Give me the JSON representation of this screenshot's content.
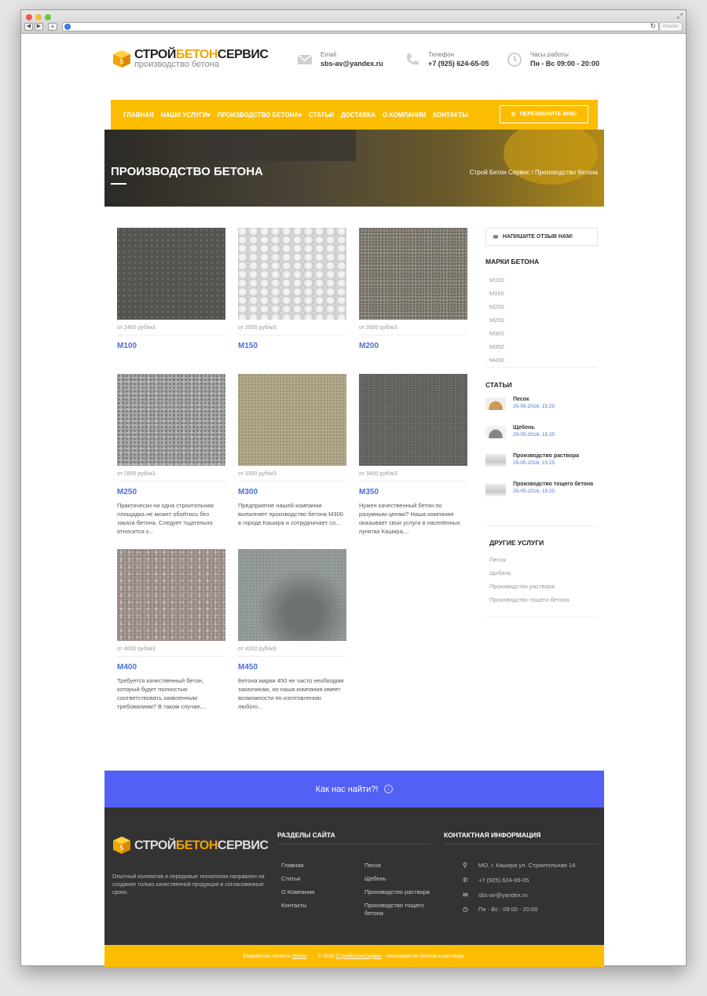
{
  "browser": {
    "reader_label": "Reader"
  },
  "header": {
    "logo_title_a": "СТРОЙ",
    "logo_title_b": "БЕТОН",
    "logo_title_c": "СЕРВИС",
    "logo_sub": "производство бетона",
    "email_label": "Email",
    "email_value": "sbs-av@yandex.ru",
    "phone_label": "Телефон",
    "phone_value": "+7 (925) 624-65-05",
    "hours_label": "Часы работы",
    "hours_value": "Пн - Вс 09:00 - 20:00"
  },
  "nav": {
    "items": [
      "ГЛАВНАЯ",
      "НАШИ УСЛУГИ▾",
      "ПРОИЗВОДСТВО БЕТОНА▾",
      "СТАТЬИ",
      "ДОСТАВКА",
      "О КОМПАНИИ",
      "КОНТАКТЫ"
    ],
    "callback": "ПЕРЕЗВОНИТЕ МНЕ!"
  },
  "hero": {
    "title": "ПРОИЗВОДСТВО БЕТОНА",
    "breadcrumb": "Строй Бетон Сервис / Производство бетона"
  },
  "products": [
    {
      "price": "от 2400 руб/м3.",
      "name": "М100",
      "desc": ""
    },
    {
      "price": "от 2500 руб/м3.",
      "name": "М150",
      "desc": ""
    },
    {
      "price": "от 2600 руб/м3.",
      "name": "М200",
      "desc": ""
    },
    {
      "price": "от 2800 руб/м3.",
      "name": "М250",
      "desc": "Практически ни одна строительная площадка не может обойтись без заказа бетона. Следует тщательно относится к..."
    },
    {
      "price": "от 3300 руб/м3.",
      "name": "М300",
      "desc": "Предприятие нашей компании выполняет производство бетона М300 в городе Кашира и сотрудничает со..."
    },
    {
      "price": "от 3400 руб/м3.",
      "name": "М350",
      "desc": "Нужен качественный бетон по разумным ценам? Наша компания оказывает свои услуги в населённых пунктах Кашира,..."
    },
    {
      "price": "от 4000 руб/м3.",
      "name": "М400",
      "desc": "Требуется качественный бетон, который будет полностью соответствовать заявленным требованиям? В таком случае,..."
    },
    {
      "price": "от 4200 руб/м3.",
      "name": "М450",
      "desc": "Бетона марки 450 не часто необходим заказчикам, но наша компания имеет возможности по изготовлению любого..."
    }
  ],
  "sidebar": {
    "review_button": "НАПИШИТЕ ОТЗЫВ НАМ!",
    "marks_title": "МАРКИ БЕТОНА",
    "marks": [
      "М100",
      "М150",
      "М200",
      "М250",
      "М300",
      "М350",
      "М400"
    ],
    "articles_title": "СТАТЬИ",
    "articles": [
      {
        "title": "Песок",
        "date": "25-05-2016, 15:25"
      },
      {
        "title": "Щебень",
        "date": "25-05-2016, 15:25"
      },
      {
        "title": "Производство раствора",
        "date": "25-05-2016, 15:25"
      },
      {
        "title": "Производство тощего бетона",
        "date": "25-05-2016, 15:25"
      }
    ],
    "other_title": "ДРУГИЕ УСЛУГИ",
    "other": [
      "Песок",
      "Щебень",
      "Производство раствора",
      "Производство тощего бетона"
    ]
  },
  "find": {
    "label": "Как нас найти?!"
  },
  "footer": {
    "about": "Опытный коллектив и передовые технологии направлен на создание только качественной продукции в согласованные сроки.",
    "sections_title": "РАЗДЕЛЫ САЙТА",
    "links_col1": [
      "Главная",
      "Статьи",
      "О Компании",
      "Контакты"
    ],
    "links_col2": [
      "Песок",
      "Щебень",
      "Производство раствора",
      "Производство тощего бетона"
    ],
    "contact_title": "КОНТАКТНАЯ ИНФОРМАЦИЯ",
    "address": "МО, г. Кашира ул. Строительная 14.",
    "phone": "+7 (925) 624-65-05",
    "email": "sbs-av@yandex.ru",
    "hours": "Пн - Вс : 09:00 - 20:00"
  },
  "bottom": {
    "dev_prefix": "Разработка проекта",
    "dev_name": "VitArts",
    "copy_prefix": "© 2016",
    "copy_name": "СтройБетонСервис",
    "copy_suffix": "- производство бетона и раствора."
  },
  "colors": {
    "accent": "#fcbd00",
    "link": "#4a70d8",
    "find_bar": "#5360f6",
    "footer": "#333333"
  }
}
